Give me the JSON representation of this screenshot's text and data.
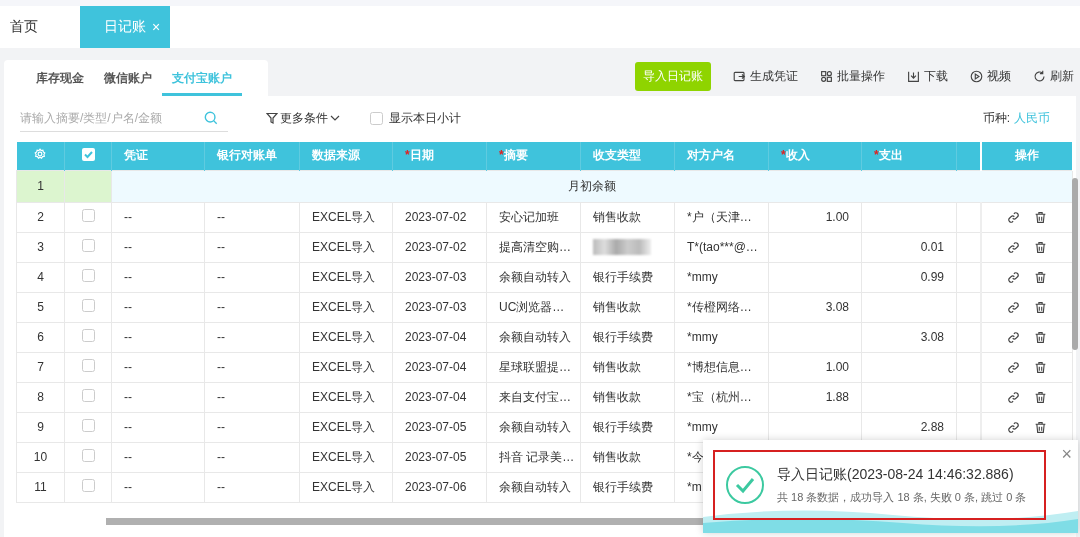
{
  "page_tabs": [
    {
      "label": "首页",
      "selected": false,
      "closable": false
    },
    {
      "label": "日记账",
      "selected": true,
      "closable": true,
      "close": "×"
    }
  ],
  "account_tabs": [
    {
      "label": "库存现金",
      "selected": false
    },
    {
      "label": "微信账户",
      "selected": false
    },
    {
      "label": "支付宝账户",
      "selected": true
    }
  ],
  "toolbar": [
    {
      "label": "导入日记账",
      "kind": "primary"
    },
    {
      "label": "生成凭证",
      "kind": "voucher"
    },
    {
      "label": "批量操作",
      "kind": "batch"
    },
    {
      "label": "下载",
      "kind": "download"
    },
    {
      "label": "视频",
      "kind": "video"
    },
    {
      "label": "刷新",
      "kind": "refresh"
    }
  ],
  "search": {
    "placeholder": "请输入摘要/类型/户名/金额"
  },
  "more_filters": "更多条件",
  "daily_subtotal": {
    "label": "显示本日小计",
    "checked": false
  },
  "currency": {
    "label": "币种:",
    "value": "人民币"
  },
  "table": {
    "select_all_checked": true,
    "required_mark": "*",
    "columns": [
      {
        "label": "凭证",
        "required": false
      },
      {
        "label": "银行对账单",
        "required": false
      },
      {
        "label": "数据来源",
        "required": false
      },
      {
        "label": "日期",
        "required": true
      },
      {
        "label": "摘要",
        "required": true
      },
      {
        "label": "收支类型",
        "required": false
      },
      {
        "label": "对方户名",
        "required": false
      },
      {
        "label": "收入",
        "required": true
      },
      {
        "label": "支出",
        "required": true
      }
    ],
    "actions_label": "操作",
    "opening_row": {
      "index": "1",
      "label": "月初余额"
    },
    "rows": [
      {
        "index": "2",
        "checked": false,
        "voucher": "--",
        "statement": "--",
        "source": "EXCEL导入",
        "date": "2023-07-02",
        "summary": "安心记加班",
        "type": "销售收款",
        "party": "*户（天津…",
        "income": "1.00",
        "expense": ""
      },
      {
        "index": "3",
        "checked": false,
        "voucher": "--",
        "statement": "--",
        "source": "EXCEL导入",
        "date": "2023-07-02",
        "summary": "提高清空购…",
        "type_blurred": true,
        "party": "T*(tao***@…",
        "income": "",
        "expense": "0.01"
      },
      {
        "index": "4",
        "checked": false,
        "voucher": "--",
        "statement": "--",
        "source": "EXCEL导入",
        "date": "2023-07-03",
        "summary": "余额自动转入",
        "type": "银行手续费",
        "party": "*mmy",
        "income": "",
        "expense": "0.99"
      },
      {
        "index": "5",
        "checked": false,
        "voucher": "--",
        "statement": "--",
        "source": "EXCEL导入",
        "date": "2023-07-03",
        "summary": "UC浏览器…",
        "type": "销售收款",
        "party": "*传橙网络…",
        "income": "3.08",
        "expense": ""
      },
      {
        "index": "6",
        "checked": false,
        "voucher": "--",
        "statement": "--",
        "source": "EXCEL导入",
        "date": "2023-07-04",
        "summary": "余额自动转入",
        "type": "银行手续费",
        "party": "*mmy",
        "income": "",
        "expense": "3.08"
      },
      {
        "index": "7",
        "checked": false,
        "voucher": "--",
        "statement": "--",
        "source": "EXCEL导入",
        "date": "2023-07-04",
        "summary": "星球联盟提…",
        "type": "销售收款",
        "party": "*博想信息…",
        "income": "1.00",
        "expense": ""
      },
      {
        "index": "8",
        "checked": false,
        "voucher": "--",
        "statement": "--",
        "source": "EXCEL导入",
        "date": "2023-07-04",
        "summary": "来自支付宝…",
        "type": "销售收款",
        "party": "*宝（杭州…",
        "income": "1.88",
        "expense": ""
      },
      {
        "index": "9",
        "checked": false,
        "voucher": "--",
        "statement": "--",
        "source": "EXCEL导入",
        "date": "2023-07-05",
        "summary": "余额自动转入",
        "type": "银行手续费",
        "party": "*mmy",
        "income": "",
        "expense": "2.88"
      },
      {
        "index": "10",
        "checked": false,
        "voucher": "--",
        "statement": "--",
        "source": "EXCEL导入",
        "date": "2023-07-05",
        "summary": "抖音 记录美…",
        "type": "销售收款",
        "party": "*今"
      },
      {
        "index": "11",
        "checked": false,
        "voucher": "--",
        "statement": "--",
        "source": "EXCEL导入",
        "date": "2023-07-06",
        "summary": "余额自动转入",
        "type": "银行手续费",
        "party": "*m"
      }
    ]
  },
  "toast": {
    "title": "导入日记账(2023-08-24 14:46:32.886)",
    "message": "共 18 条数据，成功导入 18 条, 失败 0 条, 跳过 0 条",
    "close": "×",
    "highlighted": true
  }
}
